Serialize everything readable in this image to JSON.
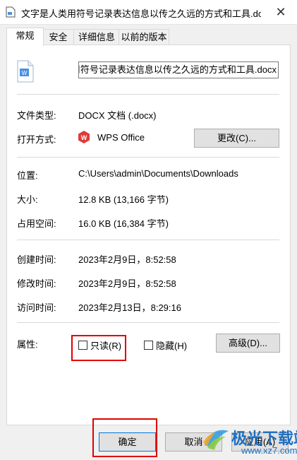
{
  "window": {
    "title": "文字是人类用符号记录表达信息以传之久远的方式和工具.docx 属..."
  },
  "tabs": [
    {
      "label": "常规"
    },
    {
      "label": "安全"
    },
    {
      "label": "详细信息"
    },
    {
      "label": "以前的版本"
    }
  ],
  "general": {
    "file_name": "文字是人类用符号记录表达信息以传之久远的方式和工具.docx",
    "type_label": "文件类型:",
    "type_value": "DOCX 文档 (.docx)",
    "open_with_label": "打开方式:",
    "open_with_value": "WPS Office",
    "change_button": "更改(C)...",
    "location_label": "位置:",
    "location_value": "C:\\Users\\admin\\Documents\\Downloads",
    "size_label": "大小:",
    "size_value": "12.8 KB (13,166 字节)",
    "size_on_disk_label": "占用空间:",
    "size_on_disk_value": "16.0 KB (16,384 字节)",
    "created_label": "创建时间:",
    "created_value": "2023年2月9日，8:52:58",
    "modified_label": "修改时间:",
    "modified_value": "2023年2月9日，8:52:58",
    "accessed_label": "访问时间:",
    "accessed_value": "2023年2月13日，8:29:16",
    "attributes_label": "属性:",
    "readonly_label": "只读(R)",
    "readonly_checked": false,
    "hidden_label": "隐藏(H)",
    "hidden_checked": false,
    "advanced_button": "高级(D)..."
  },
  "footer": {
    "ok_button": "确定",
    "cancel_button": "取消",
    "apply_button": "应用(A)"
  },
  "watermark": {
    "title": "极光下载站",
    "url": "www.xz7.com"
  },
  "colors": {
    "highlight": "#e00000",
    "wps_red": "#e03a3a",
    "doc_blue": "#4a90e2",
    "watermark_blue": "#1e6fbf"
  }
}
